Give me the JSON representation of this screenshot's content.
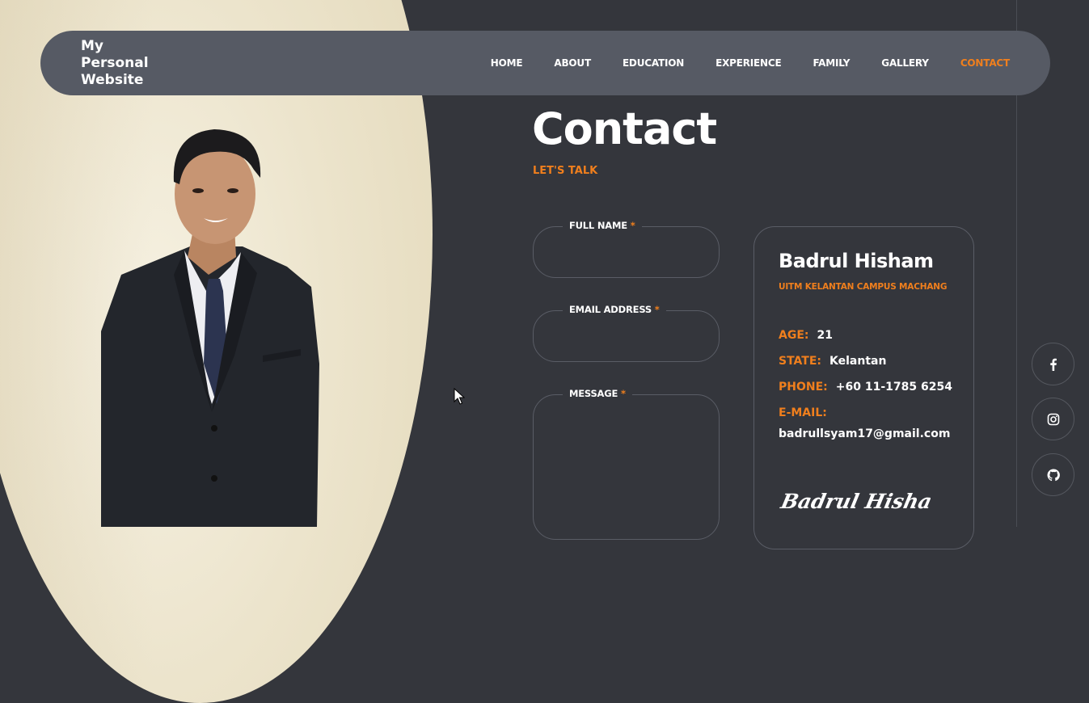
{
  "brand": {
    "line1": "My",
    "line2": "Personal",
    "line3": "Website"
  },
  "nav": {
    "items": [
      {
        "label": "HOME",
        "active": false
      },
      {
        "label": "ABOUT",
        "active": false
      },
      {
        "label": "EDUCATION",
        "active": false
      },
      {
        "label": "EXPERIENCE",
        "active": false
      },
      {
        "label": "FAMILY",
        "active": false
      },
      {
        "label": "GALLERY",
        "active": false
      },
      {
        "label": "CONTACT",
        "active": true
      }
    ]
  },
  "heading": {
    "title": "Contact",
    "subtitle": "LET'S TALK"
  },
  "form": {
    "full_name_label": "FULL NAME",
    "email_label": "EMAIL ADDRESS",
    "message_label": "MESSAGE",
    "required_mark": "*",
    "full_name_value": "",
    "email_value": "",
    "message_value": ""
  },
  "profile": {
    "name": "Badrul Hisham",
    "campus": "UITM KELANTAN CAMPUS MACHANG",
    "age_label": "AGE:",
    "age": "21",
    "state_label": "STATE:",
    "state": "Kelantan",
    "phone_label": "PHONE:",
    "phone": "+60 11-1785 6254",
    "email_label": "E-MAIL:",
    "email": "badrullsyam17@gmail.com",
    "signature": "Badrul Hisham"
  },
  "socials": [
    {
      "icon": "facebook-icon"
    },
    {
      "icon": "instagram-icon"
    },
    {
      "icon": "github-icon"
    }
  ],
  "colors": {
    "accent": "#f07f1d",
    "background": "#34363c",
    "nav": "#565a64"
  }
}
